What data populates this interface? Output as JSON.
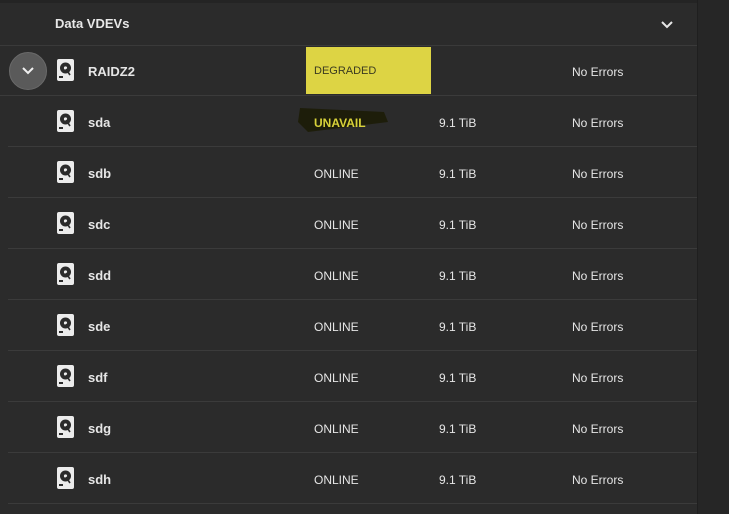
{
  "header": {
    "title": "Data VDEVs",
    "chevron_icon": "chevron-down-icon"
  },
  "vdev": {
    "name": "RAIDZ2",
    "status": "DEGRADED",
    "status_color": "#ddd444",
    "errors": "No Errors"
  },
  "disks": [
    {
      "name": "sda",
      "status": "UNAVAIL",
      "status_color": "#d8d23a",
      "size": "9.1 TiB",
      "errors": "No Errors"
    },
    {
      "name": "sdb",
      "status": "ONLINE",
      "size": "9.1 TiB",
      "errors": "No Errors"
    },
    {
      "name": "sdc",
      "status": "ONLINE",
      "size": "9.1 TiB",
      "errors": "No Errors"
    },
    {
      "name": "sdd",
      "status": "ONLINE",
      "size": "9.1 TiB",
      "errors": "No Errors"
    },
    {
      "name": "sde",
      "status": "ONLINE",
      "size": "9.1 TiB",
      "errors": "No Errors"
    },
    {
      "name": "sdf",
      "status": "ONLINE",
      "size": "9.1 TiB",
      "errors": "No Errors"
    },
    {
      "name": "sdg",
      "status": "ONLINE",
      "size": "9.1 TiB",
      "errors": "No Errors"
    },
    {
      "name": "sdh",
      "status": "ONLINE",
      "size": "9.1 TiB",
      "errors": "No Errors"
    }
  ]
}
